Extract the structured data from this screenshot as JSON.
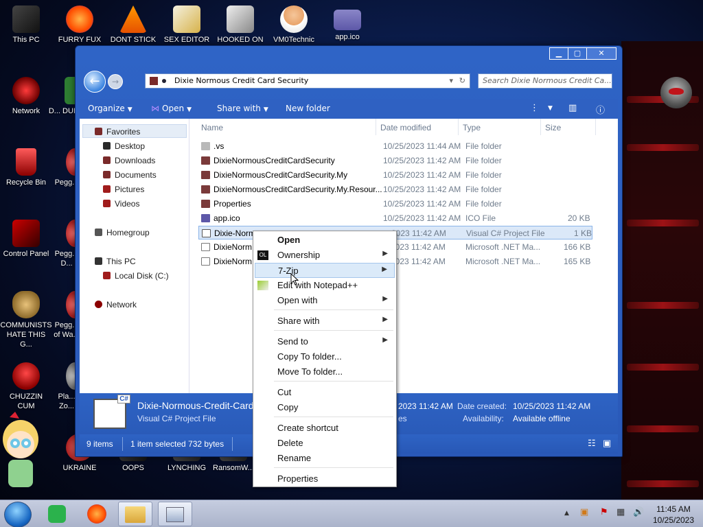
{
  "desktop": {
    "icons": [
      {
        "label": "This PC"
      },
      {
        "label": "FURRY FUX"
      },
      {
        "label": "DONT STICK"
      },
      {
        "label": "SEX EDITOR"
      },
      {
        "label": "HOOKED ON"
      },
      {
        "label": "VM0Technic"
      },
      {
        "label": "app.ico"
      },
      {
        "label": "Network"
      },
      {
        "label": "D... DUI..."
      },
      {
        "label": "Recycle Bin"
      },
      {
        "label": "Pegg..."
      },
      {
        "label": "Control Panel"
      },
      {
        "label": "Pegg... D..."
      },
      {
        "label": "COMMUNISTS HATE THIS G..."
      },
      {
        "label": "Pegg... of Wa..."
      },
      {
        "label": "CHUZZIN CUM"
      },
      {
        "label": "Pla... Zo..."
      },
      {
        "label": "UKRAINE"
      },
      {
        "label": "OOPS"
      },
      {
        "label": "LYNCHING"
      },
      {
        "label": "RansomW..."
      }
    ]
  },
  "window": {
    "buttons": {
      "minimize": "▁",
      "maximize": "▢",
      "close": "✕"
    },
    "address": "Dixie Normous Credit Card Security",
    "search_placeholder": "Search Dixie Normous Credit Ca...",
    "toolbar": {
      "organize": "Organize",
      "open": "Open",
      "share_with": "Share with",
      "new_folder": "New folder"
    },
    "nav": {
      "favorites": "Favorites",
      "desktop": "Desktop",
      "downloads": "Downloads",
      "documents": "Documents",
      "pictures": "Pictures",
      "videos": "Videos",
      "homegroup": "Homegroup",
      "this_pc": "This PC",
      "local_disk": "Local Disk (C:)",
      "network": "Network"
    },
    "columns": {
      "name": "Name",
      "date": "Date modified",
      "type": "Type",
      "size": "Size"
    },
    "files": [
      {
        "name": ".vs",
        "date": "10/25/2023 11:44 AM",
        "type": "File folder",
        "size": ""
      },
      {
        "name": "DixieNormousCreditCardSecurity",
        "date": "10/25/2023 11:42 AM",
        "type": "File folder",
        "size": ""
      },
      {
        "name": "DixieNormousCreditCardSecurity.My",
        "date": "10/25/2023 11:42 AM",
        "type": "File folder",
        "size": ""
      },
      {
        "name": "DixieNormousCreditCardSecurity.My.Resour...",
        "date": "10/25/2023 11:42 AM",
        "type": "File folder",
        "size": ""
      },
      {
        "name": "Properties",
        "date": "10/25/2023 11:42 AM",
        "type": "File folder",
        "size": ""
      },
      {
        "name": "app.ico",
        "date": "10/25/2023 11:42 AM",
        "type": "ICO File",
        "size": "20 KB"
      },
      {
        "name": "Dixie-Norm",
        "date": "2023 11:42 AM",
        "type": "Visual C# Project File",
        "size": "1 KB"
      },
      {
        "name": "DixieNorm",
        "date": "2023 11:42 AM",
        "type": "Microsoft .NET Ma...",
        "size": "166 KB"
      },
      {
        "name": "DixieNorm",
        "date": "2023 11:42 AM",
        "type": "Microsoft .NET Ma...",
        "size": "165 KB"
      }
    ],
    "details": {
      "filename": "Dixie-Normous-Credit-Card",
      "filetype": "Visual C# Project File",
      "modified_value": "2023 11:42 AM",
      "modified_suffix": "es",
      "date_created_label": "Date created:",
      "date_created_value": "10/25/2023 11:42 AM",
      "availability_label": "Availability:",
      "availability_value": "Available offline",
      "badge": "C#"
    },
    "status": {
      "items": "9 items",
      "selected": "1 item selected  732 bytes"
    }
  },
  "context_menu": {
    "open": "Open",
    "ownership": "Ownership",
    "sevenzip": "7-Zip",
    "edit_notepad": "Edit with Notepad++",
    "open_with": "Open with",
    "share_with": "Share with",
    "send_to": "Send to",
    "copy_to": "Copy To folder...",
    "move_to": "Move To folder...",
    "cut": "Cut",
    "copy": "Copy",
    "create_shortcut": "Create shortcut",
    "delete": "Delete",
    "rename": "Rename",
    "properties": "Properties",
    "ownership_icon_text": "OL"
  },
  "taskbar": {
    "time": "11:45 AM",
    "date": "10/25/2023"
  },
  "colors": {
    "accent": "#2f61c2",
    "highlight": "#dbeaf9"
  }
}
